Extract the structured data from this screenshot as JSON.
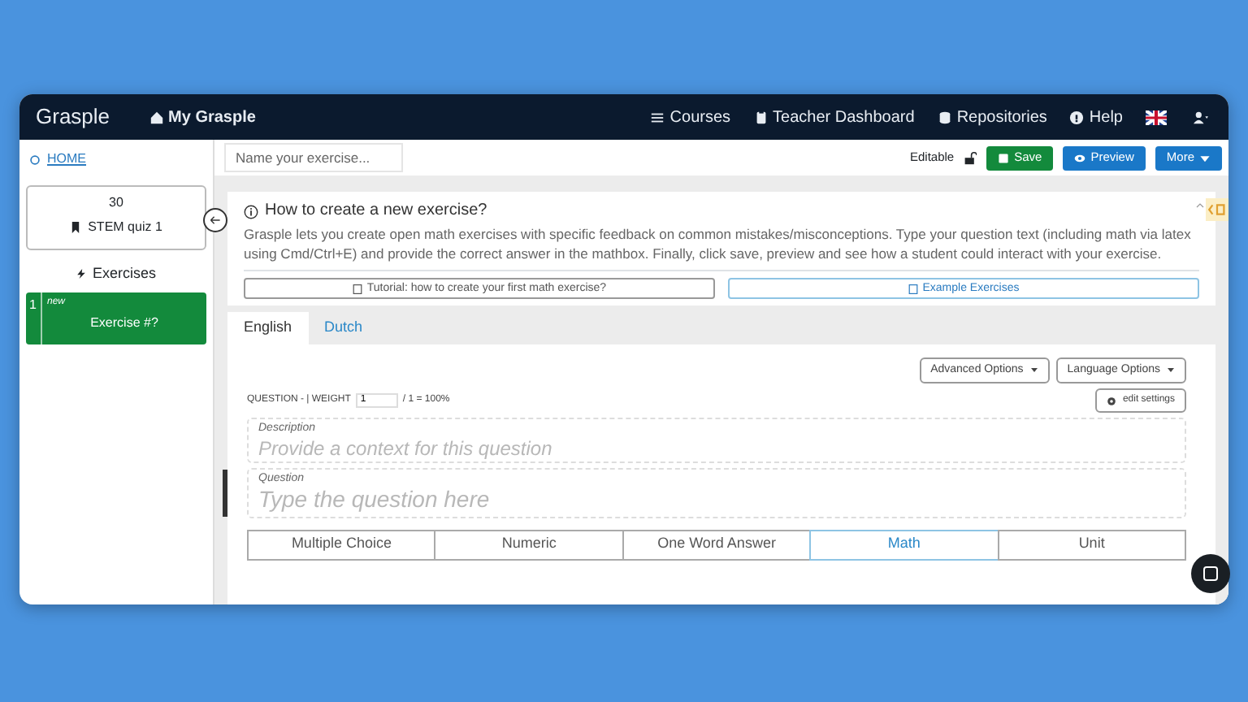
{
  "navbar": {
    "brand": "Grasple",
    "home_link": "My Grasple",
    "links": [
      {
        "kind": "courses",
        "label": "Courses"
      },
      {
        "kind": "dashboard",
        "label": "Teacher Dashboard"
      },
      {
        "kind": "repositories",
        "label": "Repositories"
      },
      {
        "kind": "help",
        "label": "Help"
      }
    ]
  },
  "sidebar": {
    "home": "HOME",
    "collection": {
      "count": "30",
      "title": "STEM quiz 1"
    },
    "exercises_heading": "Exercises",
    "exercises": [
      {
        "number": "1",
        "tag": "new",
        "title": "Exercise #?",
        "selected": true
      }
    ]
  },
  "toolbar": {
    "name_placeholder": "Name your exercise...",
    "status": "Editable",
    "buttons": [
      {
        "kind": "save",
        "label": "Save"
      },
      {
        "kind": "preview",
        "label": "Preview"
      },
      {
        "kind": "more",
        "label": "More"
      }
    ]
  },
  "info": {
    "title": "How to create a new exercise?",
    "text": "Grasple lets you create open math exercises with specific feedback on common mistakes/misconceptions. Type your question text (including math via latex using Cmd/Ctrl+E) and provide the correct answer in the mathbox. Finally, click save, preview and see how a student could interact with your exercise.",
    "links": [
      {
        "label": "Tutorial: how to create your first math exercise?",
        "highlighted": false
      },
      {
        "label": "Example Exercises",
        "highlighted": true
      }
    ]
  },
  "language_tabs": [
    {
      "label": "English",
      "selected": true
    },
    {
      "label": "Dutch",
      "selected": false
    }
  ],
  "options": [
    "Advanced Options",
    "Language Options"
  ],
  "question": {
    "heading": "QUESTION -  | WEIGHT",
    "weight": "1",
    "total": "/ 1 = 100%",
    "edit": "edit settings",
    "description_label": "Description",
    "description_placeholder": "Provide a context for this question",
    "question_label": "Question",
    "question_placeholder": "Type the question here"
  },
  "answer_types": [
    {
      "label": "Multiple Choice",
      "selected": false
    },
    {
      "label": "Numeric",
      "selected": false
    },
    {
      "label": "One Word Answer",
      "selected": false
    },
    {
      "label": "Math",
      "selected": true
    },
    {
      "label": "Unit",
      "selected": false
    }
  ]
}
